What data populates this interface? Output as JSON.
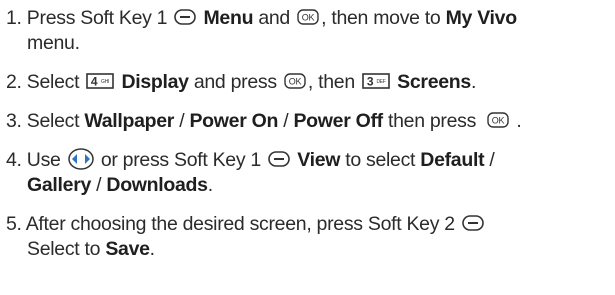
{
  "steps": [
    {
      "n": "1.",
      "t1": "Press Soft Key 1",
      "t2": "Menu",
      "t3": "and",
      "t4": ", then move to",
      "t5": "My Vivo",
      "t6": "menu."
    },
    {
      "n": "2.",
      "t1": "Select",
      "t2": "Display",
      "t3": "and press",
      "t4": ", then",
      "t5": "Screens",
      "t6": "."
    },
    {
      "n": "3.",
      "t1": "Select",
      "t2": "Wallpaper",
      "t3": "/",
      "t4": "Power On",
      "t5": "/",
      "t6": "Power Off",
      "t7": "then press",
      "t8": "."
    },
    {
      "n": "4.",
      "t1": "Use",
      "t2": "or press Soft Key 1",
      "t3": "View",
      "t4": "to select",
      "t5": "Default",
      "t6": "/",
      "t7": "Gallery",
      "t8": "/",
      "t9": "Downloads",
      "t10": "."
    },
    {
      "n": "5.",
      "t1": "After choosing the desired screen, press Soft Key 2",
      "t2": "Select to",
      "t3": "Save",
      "t4": "."
    }
  ],
  "icons": {
    "ok_label": "OK",
    "key4_digit": "4",
    "key4_letters": "GHI",
    "key3_digit": "3",
    "key3_letters": "DEF",
    "softkey": "softkey-icon",
    "ok": "ok-key-icon",
    "nav": "navigation-key-icon"
  },
  "colors": {
    "text": "#2b2b2b",
    "bold": "#1f1f1f",
    "key_fill": "#ffffff",
    "key_stroke": "#333333",
    "nav_blue": "#2f74c0"
  }
}
